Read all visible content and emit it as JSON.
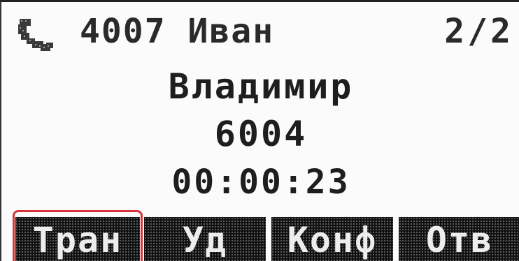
{
  "status": {
    "icon": "handset-icon",
    "line_label": "4007 Иван",
    "line_count": "2/2"
  },
  "call": {
    "name": "Владимир",
    "number": "6004",
    "timer": "00:00:23"
  },
  "softkeys": [
    {
      "label": "Тран"
    },
    {
      "label": "Уд"
    },
    {
      "label": "Конф"
    },
    {
      "label": "Отв"
    }
  ],
  "colors": {
    "screen": "#fbfbfb",
    "softkey_bg": "#111111",
    "softkey_text": "#ededed",
    "highlight": "#d9343b"
  }
}
